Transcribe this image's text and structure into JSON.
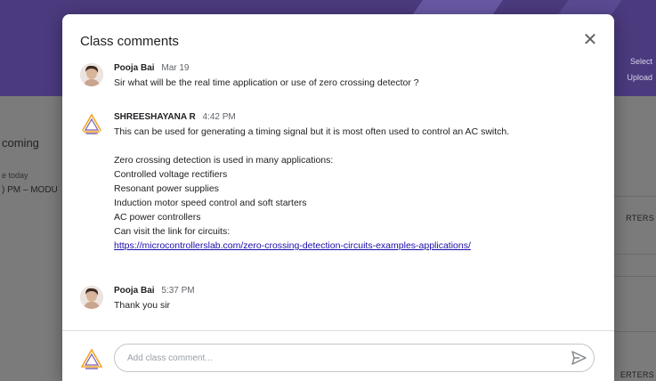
{
  "background": {
    "banner_tag_1": "Select",
    "banner_tag_2": "Upload",
    "upcoming_title": "coming",
    "upcoming_due": "e today",
    "upcoming_item": ") PM – MODU",
    "right_item_1": "RTERS",
    "right_item_2": "ERTERS"
  },
  "modal": {
    "title": "Class comments",
    "close_label": "✕",
    "comments": [
      {
        "author": "Pooja Bai",
        "date": "Mar 19",
        "lines": [
          "Sir what will be the real time application or use of zero crossing detector ?"
        ]
      },
      {
        "author": "SHREESHAYANA R",
        "date": "4:42 PM",
        "lines": [
          "This can be used for generating a timing signal but it is most often used to control an AC switch.",
          "",
          "Zero crossing detection is used in many applications:",
          "Controlled voltage rectifiers",
          "Resonant power supplies",
          "Induction motor speed control and soft starters",
          "AC power controllers",
          "Can visit the link for circuits:"
        ],
        "link": "https://microcontrollerslab.com/zero-crossing-detection-circuits-examples-applications/"
      },
      {
        "author": "Pooja Bai",
        "date": "5:37 PM",
        "lines": [
          "Thank you sir"
        ]
      }
    ],
    "input_placeholder": "Add class comment..."
  },
  "colors": {
    "banner": "#4b3a7e",
    "link": "#1a0dab",
    "logo_orange": "#f5a623",
    "logo_purple": "#7b5ea7"
  },
  "icons": {
    "close": "close-icon",
    "send": "send-icon",
    "avatar_photo": "user-photo",
    "avatar_logo": "triangle-logo"
  }
}
